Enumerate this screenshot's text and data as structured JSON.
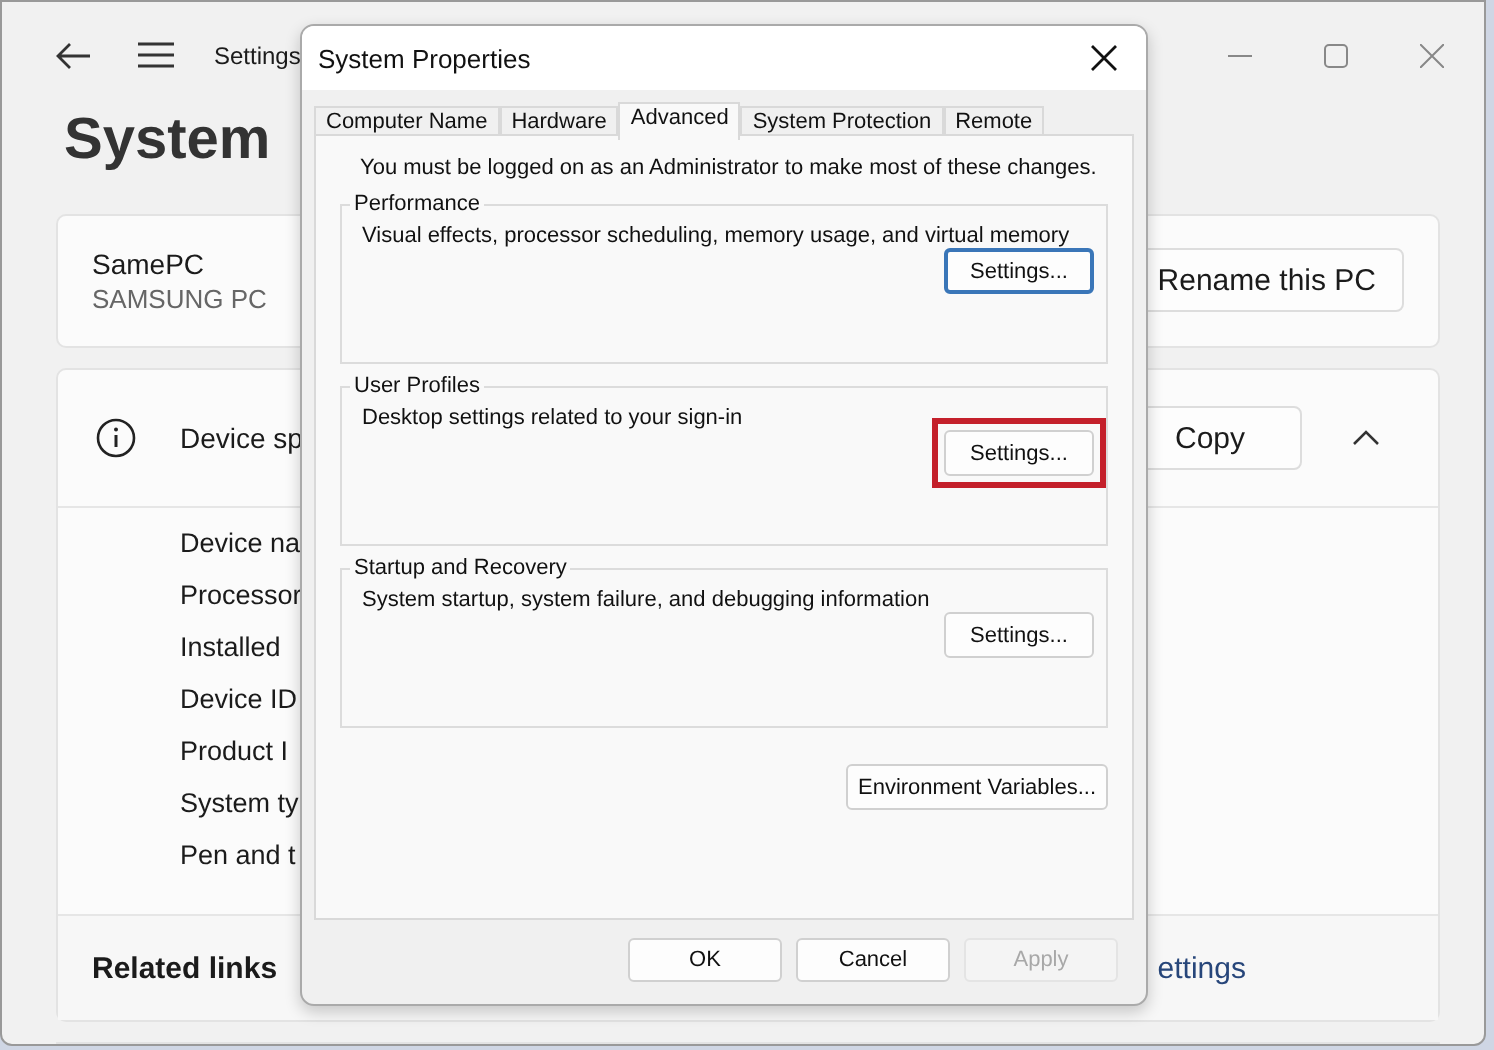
{
  "settings_window": {
    "title": "Settings",
    "heading": "System",
    "device": {
      "name": "SamePC",
      "model": "SAMSUNG PC",
      "rename_button": "Rename this PC"
    },
    "specs": {
      "title": "Device sp",
      "copy_button": "Copy",
      "expanded": true,
      "rows": [
        "Device na",
        "Processor",
        "Installed",
        "Device ID",
        "Product I",
        "System ty",
        "Pen and t"
      ]
    },
    "related": {
      "title": "Related links",
      "link": "ettings"
    }
  },
  "dialog": {
    "title": "System Properties",
    "tabs": [
      {
        "label": "Computer Name",
        "selected": false
      },
      {
        "label": "Hardware",
        "selected": false
      },
      {
        "label": "Advanced",
        "selected": true
      },
      {
        "label": "System Protection",
        "selected": false
      },
      {
        "label": "Remote",
        "selected": false
      }
    ],
    "notice": "You must be logged on as an Administrator to make most of these changes.",
    "groups": [
      {
        "title": "Performance",
        "description": "Visual effects, processor scheduling, memory usage, and virtual memory",
        "button": "Settings...",
        "focused": true,
        "highlighted": false
      },
      {
        "title": "User Profiles",
        "description": "Desktop settings related to your sign-in",
        "button": "Settings...",
        "focused": false,
        "highlighted": true
      },
      {
        "title": "Startup and Recovery",
        "description": "System startup, system failure, and debugging information",
        "button": "Settings...",
        "focused": false,
        "highlighted": false
      }
    ],
    "env_button": "Environment Variables...",
    "footer_buttons": [
      {
        "label": "OK",
        "disabled": false
      },
      {
        "label": "Cancel",
        "disabled": false
      },
      {
        "label": "Apply",
        "disabled": true
      }
    ]
  }
}
